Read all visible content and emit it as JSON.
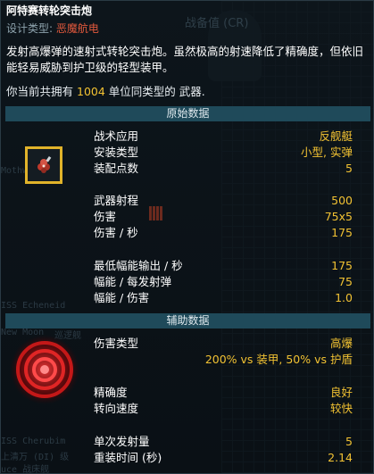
{
  "tooltip": {
    "title": "阿特赛转轮突击炮",
    "design_label": "设计类型:",
    "design_value": "恶魔航电",
    "description": "发射高爆弹的速射式转轮突击炮。虽然极高的射速降低了精确度，但依旧能轻易威胁到护卫级的轻型装甲。",
    "own_prefix": "你当前共拥有",
    "own_count": "1004",
    "own_suffix": "单位同类型的 武器.",
    "section_primary": "原始数据",
    "section_secondary": "辅助数据",
    "primary_stats": [
      {
        "label": "战术应用",
        "value": "反舰艇"
      },
      {
        "label": "安装类型",
        "value": "小型, 实弹"
      },
      {
        "label": "装配点数",
        "value": "5"
      },
      {
        "label": "武器射程",
        "value": "500"
      },
      {
        "label": "伤害",
        "value": "75x5"
      },
      {
        "label": "伤害 / 秒",
        "value": "175"
      },
      {
        "label": "最低幅能输出 / 秒",
        "value": "175"
      },
      {
        "label": "幅能 / 每发射弹",
        "value": "75"
      },
      {
        "label": "幅能 / 伤害",
        "value": "1.0"
      }
    ],
    "secondary_stats": [
      {
        "label": "伤害类型",
        "value": "高爆"
      },
      {
        "label": "精确度",
        "value": "良好"
      },
      {
        "label": "转向速度",
        "value": "较快"
      },
      {
        "label": "单次发射量",
        "value": "5"
      },
      {
        "label": "重装时间 (秒)",
        "value": "2.14"
      }
    ],
    "damage_modifier": "200% vs 装甲, 50% vs 护盾"
  },
  "background": {
    "header_right": "战备值 (CR)",
    "ghost_1": "Mothworth",
    "ghost_2": "ISS Echeneid",
    "ghost_3": "New Moon",
    "ghost_3_suffix": "巡逻舰",
    "ghost_4": "ISS Cherubim",
    "ghost_5": "上清万 (DI) 级",
    "ghost_6": "uce 战床舰"
  },
  "icons": {
    "weapon": "weapon-cluster-icon",
    "ammo": "ammo-bars-icon",
    "damage_type": "high-explosive-target-icon"
  },
  "colors": {
    "accent_yellow": "#f2c232",
    "design_red": "#e0583c",
    "section_bar": "#1f4a5a",
    "icon_frame": "#e1b32a"
  }
}
